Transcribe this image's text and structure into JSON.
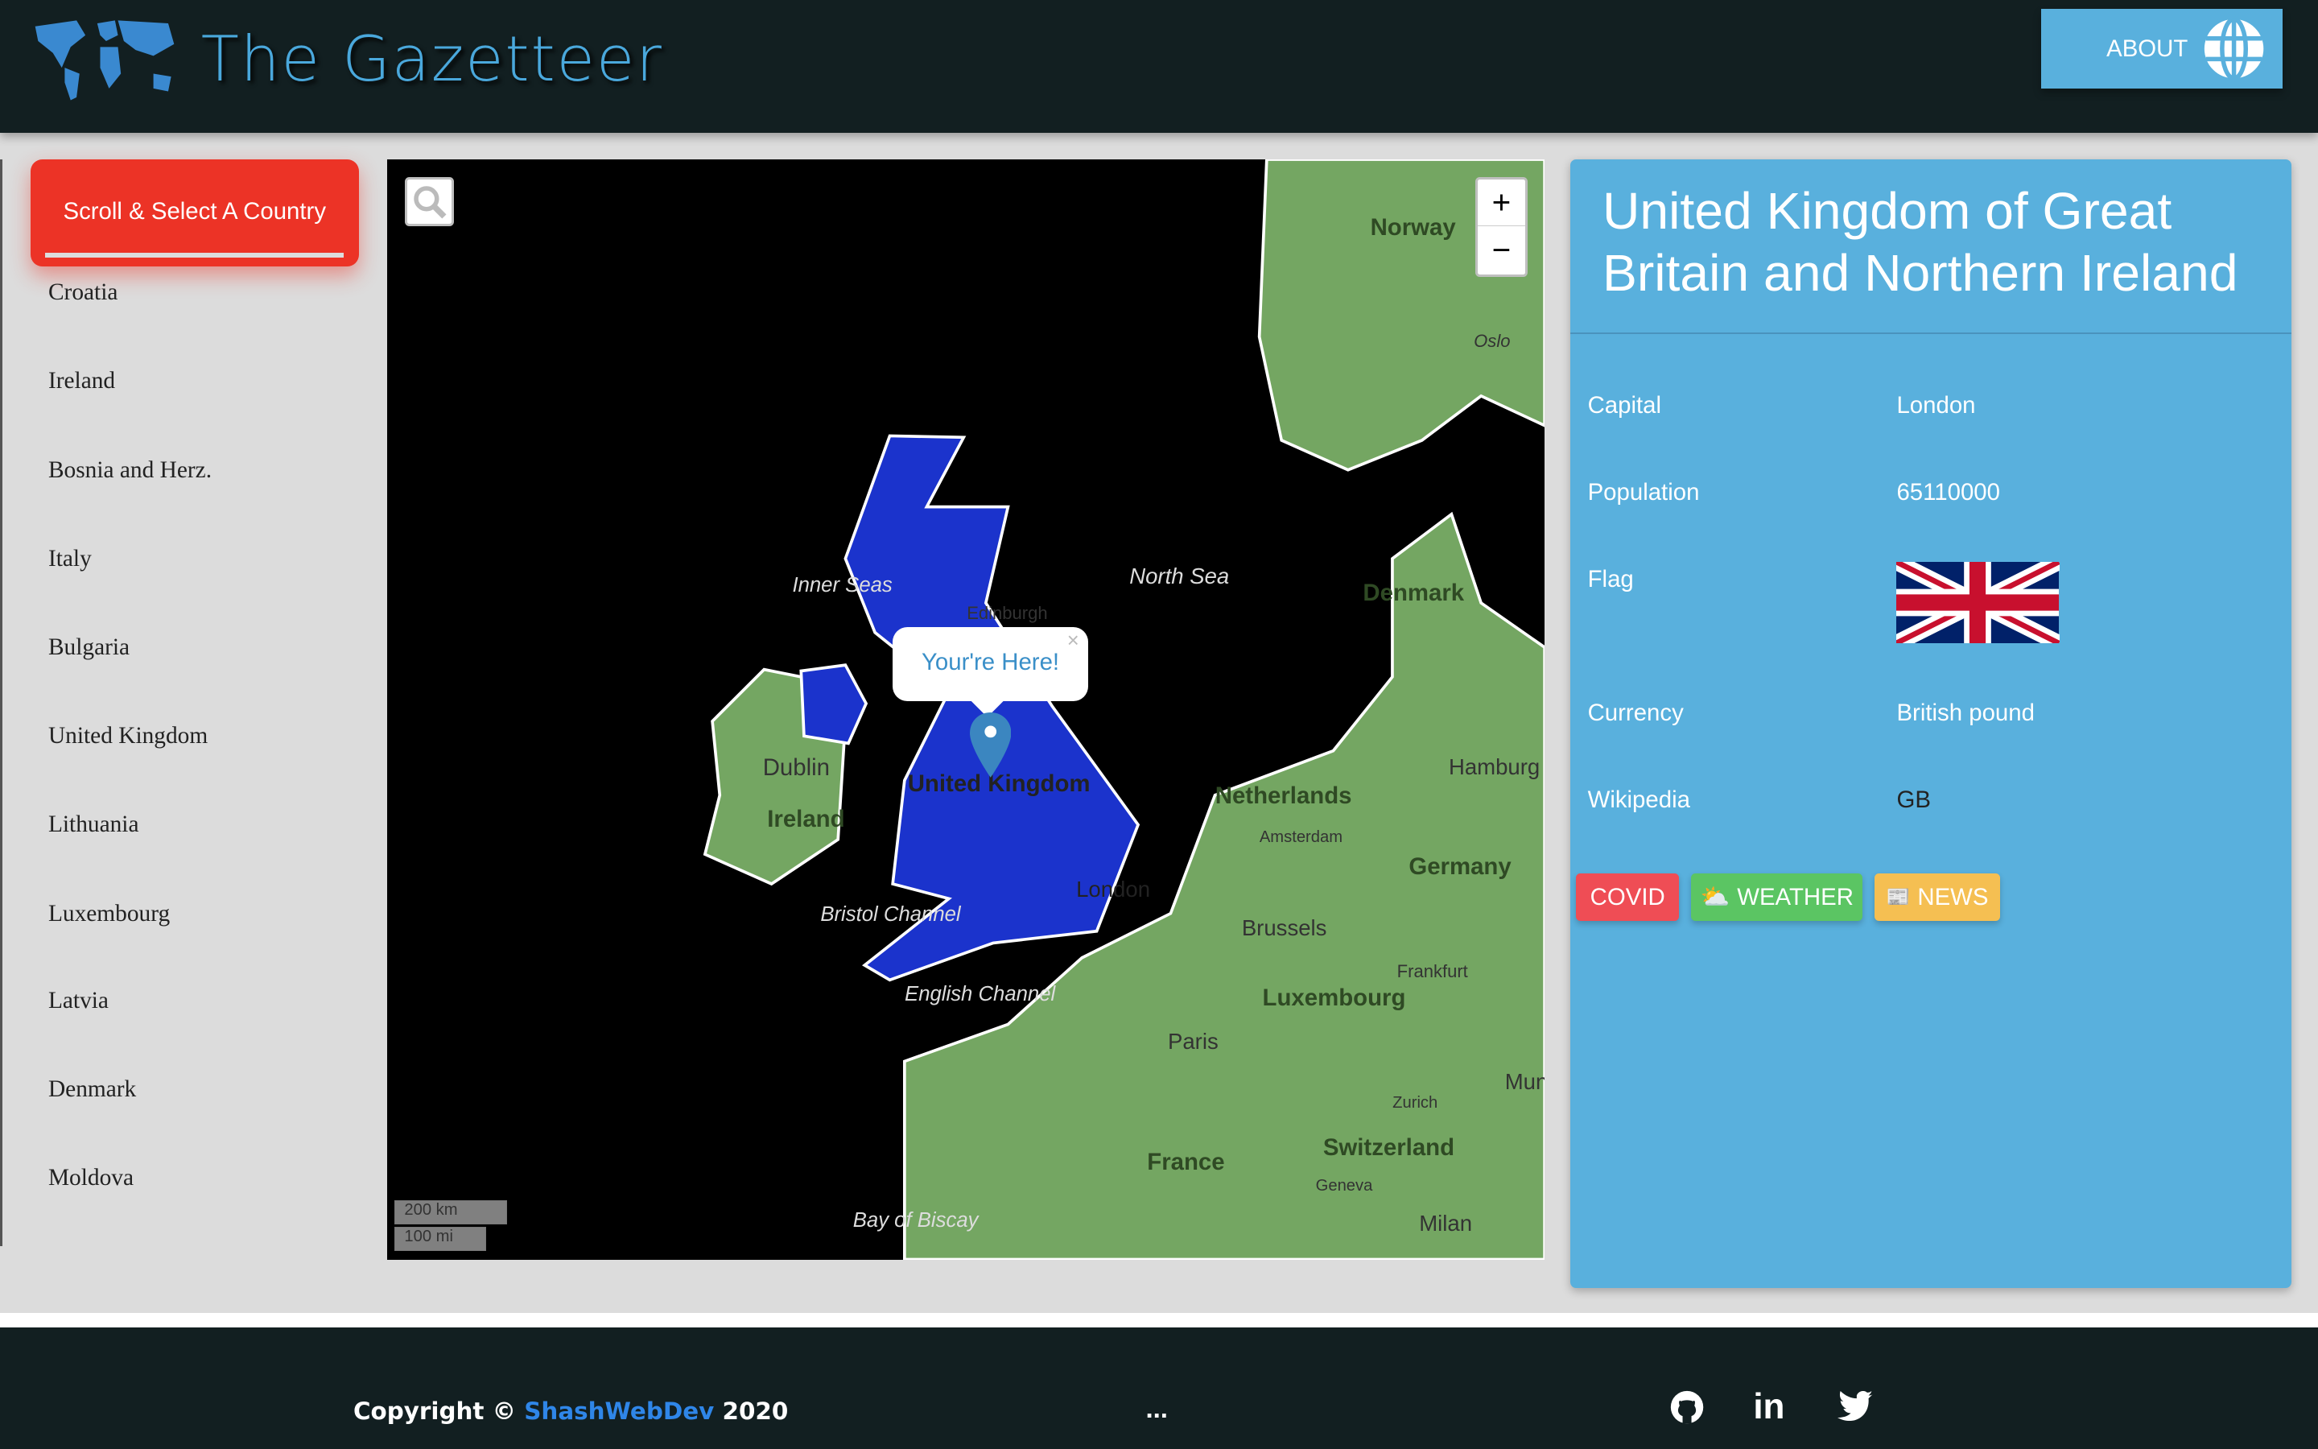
{
  "header": {
    "title": "The Gazetteer",
    "about_label": "ABOUT",
    "logo_icon": "world-map-icon",
    "about_icon": "globe-icon"
  },
  "sidebar": {
    "select_label": "Scroll & Select A Country",
    "countries": [
      "Croatia",
      "Ireland",
      "Bosnia and Herz.",
      "Italy",
      "Bulgaria",
      "United Kingdom",
      "Lithuania",
      "Luxembourg",
      "Latvia",
      "Denmark",
      "Moldova"
    ]
  },
  "map": {
    "popup": "Your're Here!",
    "zoom_in": "+",
    "zoom_out": "−",
    "scale_km": "200 km",
    "scale_mi": "100 mi",
    "labels": {
      "norway": "Norway",
      "oslo": "Oslo",
      "north_sea": "North Sea",
      "denmark": "Denmark",
      "inner_seas": "Inner Seas",
      "edinburgh": "Edinburgh",
      "dublin": "Dublin",
      "ireland": "Ireland",
      "uk": "United Kingdom",
      "hamburg": "Hamburg",
      "netherlands": "Netherlands",
      "amsterdam": "Amsterdam",
      "germany": "Germany",
      "bristol": "Bristol Channel",
      "london": "London",
      "brussels": "Brussels",
      "frankfurt": "Frankfurt",
      "luxembourg": "Luxembourg",
      "english_channel": "English Channel",
      "paris": "Paris",
      "munich": "Munich",
      "zurich": "Zurich",
      "switzerland": "Switzerland",
      "france": "France",
      "geneva": "Geneva",
      "milan": "Milan",
      "biscay": "Bay of Biscay"
    },
    "colors": {
      "land": "#74a662",
      "sea": "#000000",
      "selected": "#1b33cc"
    }
  },
  "country": {
    "name": "United Kingdom of Great Britain and Northern Ireland",
    "fields": [
      {
        "label": "Capital",
        "value": "London"
      },
      {
        "label": "Population",
        "value": "65110000"
      },
      {
        "label": "Flag",
        "value": ""
      },
      {
        "label": "Currency",
        "value": "British pound"
      },
      {
        "label": "Wikipedia",
        "value": "GB"
      }
    ]
  },
  "buttons": {
    "covid": "COVID",
    "weather": "WEATHER",
    "news": "NEWS",
    "colors": {
      "covid": "#ef4d55",
      "weather": "#5bc563",
      "news": "#f5bf52"
    }
  },
  "footer": {
    "copyright": "Copyright © ",
    "author": "ShashWebDev",
    "year": " 2020",
    "dots": "...",
    "icons": [
      "github-icon",
      "linkedin-icon",
      "twitter-icon"
    ]
  }
}
